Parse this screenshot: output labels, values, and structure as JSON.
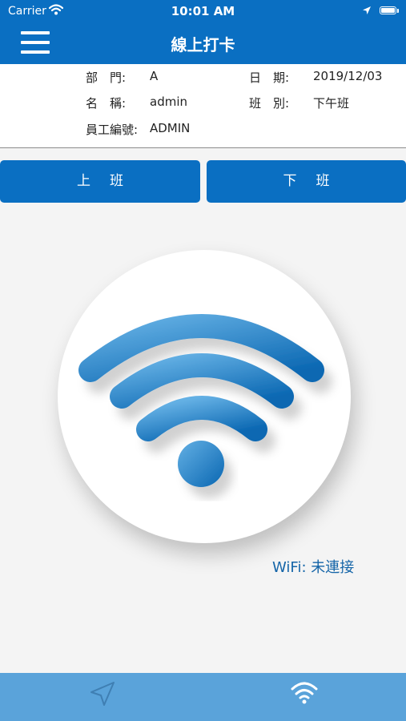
{
  "status_bar": {
    "carrier": "Carrier",
    "time": "10:01 AM",
    "icons": [
      "wifi-signal-icon",
      "location-arrow-icon",
      "battery-icon"
    ]
  },
  "nav": {
    "title": "線上打卡",
    "menu_icon": "hamburger-menu-icon"
  },
  "info": {
    "department": {
      "label": "部　門:",
      "value": "A"
    },
    "date": {
      "label": "日　期:",
      "value": "2019/12/03"
    },
    "name": {
      "label": "名　稱:",
      "value": "admin"
    },
    "shift": {
      "label": "班　別:",
      "value": "下午班"
    },
    "employee_id": {
      "label": "員工編號:",
      "value": "ADMIN"
    }
  },
  "buttons": {
    "clock_in": "上班",
    "clock_out": "下班"
  },
  "wifi": {
    "icon": "wifi-icon",
    "label": "WiFi:",
    "status": "未連接"
  },
  "tabbar": {
    "tabs": [
      {
        "icon": "navigation-arrow-icon"
      },
      {
        "icon": "wifi-icon"
      }
    ]
  },
  "colors": {
    "primary": "#0a6fc2",
    "tabbar": "#5aa3da",
    "background": "#f4f4f4",
    "wifi_gradient_start": "#5aa9e0",
    "wifi_gradient_end": "#0a68b4"
  }
}
